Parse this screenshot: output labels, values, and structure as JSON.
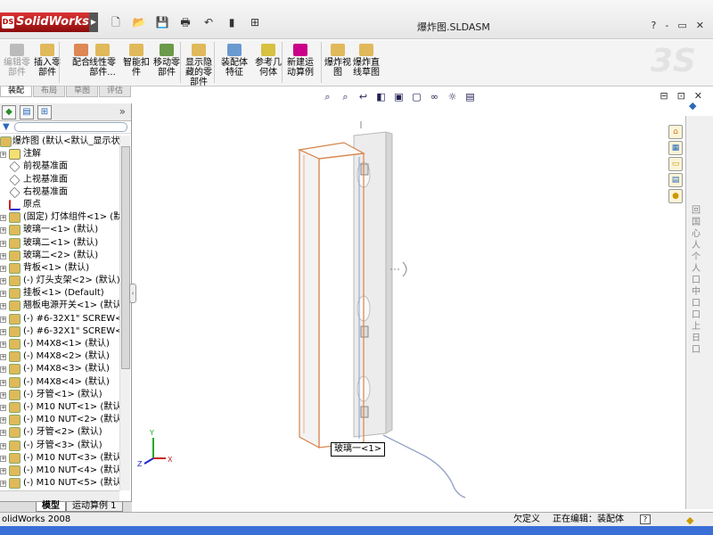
{
  "app": {
    "name": "SolidWorks",
    "doc_title": "爆炸图.SLDASM"
  },
  "quick_access": [
    "new-icon",
    "open-icon",
    "save-icon",
    "print-icon",
    "undo-icon",
    "rebuild-icon",
    "options-icon"
  ],
  "window_controls": [
    "?",
    "-",
    "▭",
    "✕"
  ],
  "command_manager": {
    "buttons": [
      {
        "label": "编辑零\n部件",
        "disabled": true
      },
      {
        "label": "插入零\n部件"
      },
      {
        "label": "配合"
      },
      {
        "label": "线性零\n部件..."
      },
      {
        "label": "智能扣\n件"
      },
      {
        "label": "移动零\n部件"
      },
      {
        "label": "显示隐\n藏的零\n部件"
      },
      {
        "label": "装配体\n特征"
      },
      {
        "label": "参考几\n何体"
      },
      {
        "label": "新建运\n动算例"
      },
      {
        "label": "爆炸视\n图"
      },
      {
        "label": "爆炸直\n线草图"
      }
    ],
    "tabs": [
      "装配",
      "布局",
      "草图",
      "评估"
    ]
  },
  "viewport_controls": [
    "⊟",
    "⊡",
    "✕"
  ],
  "feature_tree": {
    "root": "爆炸图 (默认<默认_显示状态",
    "items": [
      {
        "label": "注解",
        "exp": true,
        "icon": "annotation"
      },
      {
        "label": "前视基准面",
        "exp": false,
        "icon": "plane"
      },
      {
        "label": "上视基准面",
        "exp": false,
        "icon": "plane"
      },
      {
        "label": "右视基准面",
        "exp": false,
        "icon": "plane"
      },
      {
        "label": "原点",
        "exp": false,
        "icon": "origin"
      },
      {
        "label": "(固定) 灯体组件<1> (默认",
        "exp": true,
        "icon": "part"
      },
      {
        "label": "玻璃一<1> (默认)",
        "exp": true,
        "icon": "part"
      },
      {
        "label": "玻璃二<1> (默认)",
        "exp": true,
        "icon": "part"
      },
      {
        "label": "玻璃二<2> (默认)",
        "exp": true,
        "icon": "part"
      },
      {
        "label": "背板<1> (默认)",
        "exp": true,
        "icon": "part"
      },
      {
        "label": "(-) 灯头支架<2> (默认)",
        "exp": true,
        "icon": "part"
      },
      {
        "label": "挂板<1> (Default)",
        "exp": true,
        "icon": "part"
      },
      {
        "label": "翘板电源开关<1> (默认)",
        "exp": true,
        "icon": "part"
      },
      {
        "label": "(-) #6-32X1\" SCREW<1> (",
        "exp": true,
        "icon": "part"
      },
      {
        "label": "(-) #6-32X1\" SCREW<2> (",
        "exp": true,
        "icon": "part"
      },
      {
        "label": "(-) M4X8<1> (默认)",
        "exp": true,
        "icon": "part"
      },
      {
        "label": "(-) M4X8<2> (默认)",
        "exp": true,
        "icon": "part"
      },
      {
        "label": "(-) M4X8<3> (默认)",
        "exp": true,
        "icon": "part"
      },
      {
        "label": "(-) M4X8<4> (默认)",
        "exp": true,
        "icon": "part"
      },
      {
        "label": "(-) 牙管<1> (默认)",
        "exp": true,
        "icon": "part"
      },
      {
        "label": "(-) M10 NUT<1> (默认)",
        "exp": true,
        "icon": "part"
      },
      {
        "label": "(-) M10 NUT<2> (默认)",
        "exp": true,
        "icon": "part"
      },
      {
        "label": "(-) 牙管<2> (默认)",
        "exp": true,
        "icon": "part"
      },
      {
        "label": "(-) 牙管<3> (默认)",
        "exp": true,
        "icon": "part"
      },
      {
        "label": "(-) M10 NUT<3> (默认)",
        "exp": true,
        "icon": "part"
      },
      {
        "label": "(-) M10 NUT<4> (默认)",
        "exp": true,
        "icon": "part"
      },
      {
        "label": "(-) M10 NUT<5> (默认)",
        "exp": true,
        "icon": "part"
      }
    ]
  },
  "bottom_tabs": [
    "模型",
    "运动算例 1"
  ],
  "viewport": {
    "tooltip": "玻璃一<1>",
    "triad_labels": [
      "Y",
      "Z",
      "X"
    ]
  },
  "task_pane_chars": "回国心人个人口中口口上日口",
  "status": {
    "app": "olidWorks 2008",
    "definition": "欠定义",
    "editing": "正在编辑：装配体",
    "help": "?"
  },
  "colors": {
    "selection_orange": "#d7844a",
    "tree_part_icon": "#e0b95a",
    "accent_blue": "#2a6ab8"
  }
}
